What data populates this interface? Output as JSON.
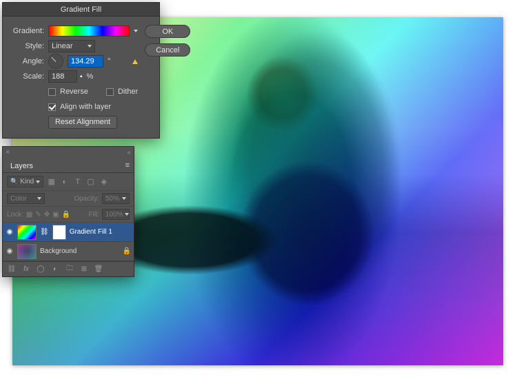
{
  "gradient_fill": {
    "title": "Gradient Fill",
    "gradient_label": "Gradient:",
    "style_label": "Style:",
    "style_value": "Linear",
    "angle_label": "Angle:",
    "angle_value": "134.29",
    "angle_suffix": "°",
    "scale_label": "Scale:",
    "scale_value": "188",
    "scale_unit": "%",
    "reverse_label": "Reverse",
    "reverse_checked": false,
    "dither_label": "Dither",
    "dither_checked": false,
    "align_label": "Align with layer",
    "align_checked": true,
    "reset_label": "Reset Alignment",
    "ok_label": "OK",
    "cancel_label": "Cancel"
  },
  "layers_panel": {
    "tab_label": "Layers",
    "kind_label": "Kind",
    "blend_label": "Color",
    "opacity_label": "Opacity:",
    "opacity_value": "50%",
    "lock_label": "Lock:",
    "fill_label": "Fill:",
    "fill_value": "100%",
    "layers": [
      {
        "name": "Gradient Fill 1",
        "locked": false,
        "active": true
      },
      {
        "name": "Background",
        "locked": true,
        "active": false
      }
    ]
  }
}
